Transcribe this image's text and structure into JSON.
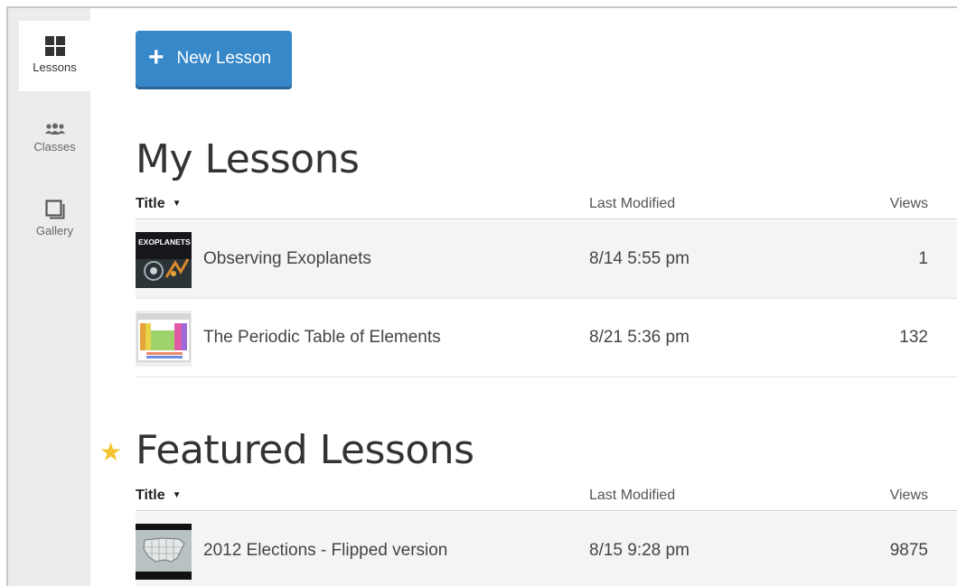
{
  "sidebar": {
    "items": [
      {
        "label": "Lessons",
        "icon": "grid-icon",
        "active": true
      },
      {
        "label": "Classes",
        "icon": "group-icon",
        "active": false
      },
      {
        "label": "Gallery",
        "icon": "stacked-squares-icon",
        "active": false
      }
    ]
  },
  "toolbar": {
    "new_lesson_label": "New Lesson",
    "accent_color": "#3788c9"
  },
  "my_lessons": {
    "title": "My Lessons",
    "columns": {
      "title": "Title",
      "modified": "Last Modified",
      "views": "Views"
    },
    "rows": [
      {
        "title": "Observing Exoplanets",
        "modified": "8/14 5:55 pm",
        "views": "1",
        "thumb": "exoplanets-thumbnail",
        "thumb_text": "EXOPLANETS"
      },
      {
        "title": "The Periodic Table of Elements",
        "modified": "8/21 5:36 pm",
        "views": "132",
        "thumb": "periodic-table-thumbnail"
      }
    ]
  },
  "featured_lessons": {
    "title": "Featured Lessons",
    "icon": "star-icon",
    "star_color": "#f4c430",
    "columns": {
      "title": "Title",
      "modified": "Last Modified",
      "views": "Views"
    },
    "rows": [
      {
        "title": "2012 Elections - Flipped version",
        "modified": "8/15 9:28 pm",
        "views": "9875",
        "thumb": "us-map-thumbnail"
      }
    ]
  }
}
